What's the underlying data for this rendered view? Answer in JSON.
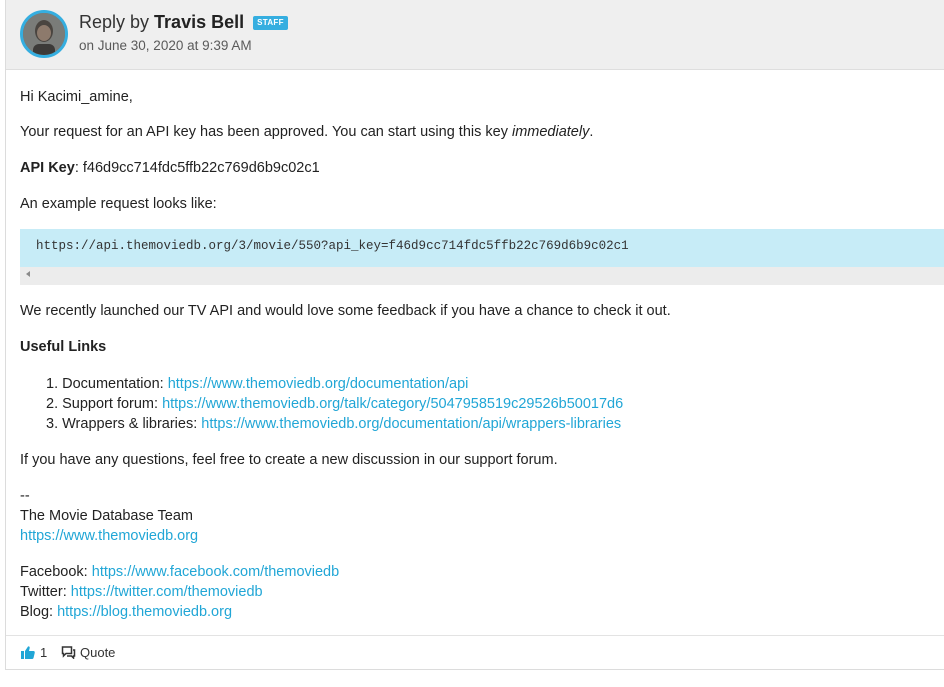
{
  "header": {
    "reply_prefix": "Reply by",
    "author": "Travis Bell",
    "badge": "STAFF",
    "date": "on June 30, 2020 at 9:39 AM"
  },
  "body": {
    "greeting": "Hi Kacimi_amine,",
    "approved_text": "Your request for an API key has been approved. You can start using this key ",
    "approved_emphasis": "immediately",
    "approved_end": ".",
    "api_key_label": "API Key",
    "api_key_sep": ":",
    "api_key_value": " f46d9cc714fdc5ffb22c769d6b9c02c1",
    "example_intro": "An example request looks like:",
    "example_code": "https://api.themoviedb.org/3/movie/550?api_key=f46d9cc714fdc5ffb22c769d6b9c02c1",
    "tv_api_text": "We recently launched our TV API and would love some feedback if you have a chance to check it out.",
    "useful_links_heading": "Useful Links",
    "links": [
      {
        "num": "1.",
        "label": "Documentation: ",
        "url": "https://www.themoviedb.org/documentation/api"
      },
      {
        "num": "2.",
        "label": "Support forum: ",
        "url": "https://www.themoviedb.org/talk/category/5047958519c29526b50017d6"
      },
      {
        "num": "3.",
        "label": "Wrappers & libraries: ",
        "url": "https://www.themoviedb.org/documentation/api/wrappers-libraries"
      }
    ],
    "questions_text": "If you have any questions, feel free to create a new discussion in our support forum.",
    "sig_dashes": "--",
    "sig_team": "The Movie Database Team",
    "sig_url": "https://www.themoviedb.org",
    "facebook_label": "Facebook: ",
    "facebook_url": "https://www.facebook.com/themoviedb",
    "twitter_label": "Twitter: ",
    "twitter_url": "https://twitter.com/themoviedb",
    "blog_label": "Blog: ",
    "blog_url": "https://blog.themoviedb.org"
  },
  "footer": {
    "like_icon": "thumbs-up-icon",
    "like_count": "1",
    "quote_icon": "quote-icon",
    "quote_label": "Quote"
  },
  "colors": {
    "accent": "#35aee0",
    "link": "#21a6d6",
    "code_bg": "#c7ecf7",
    "header_bg": "#efefef"
  }
}
